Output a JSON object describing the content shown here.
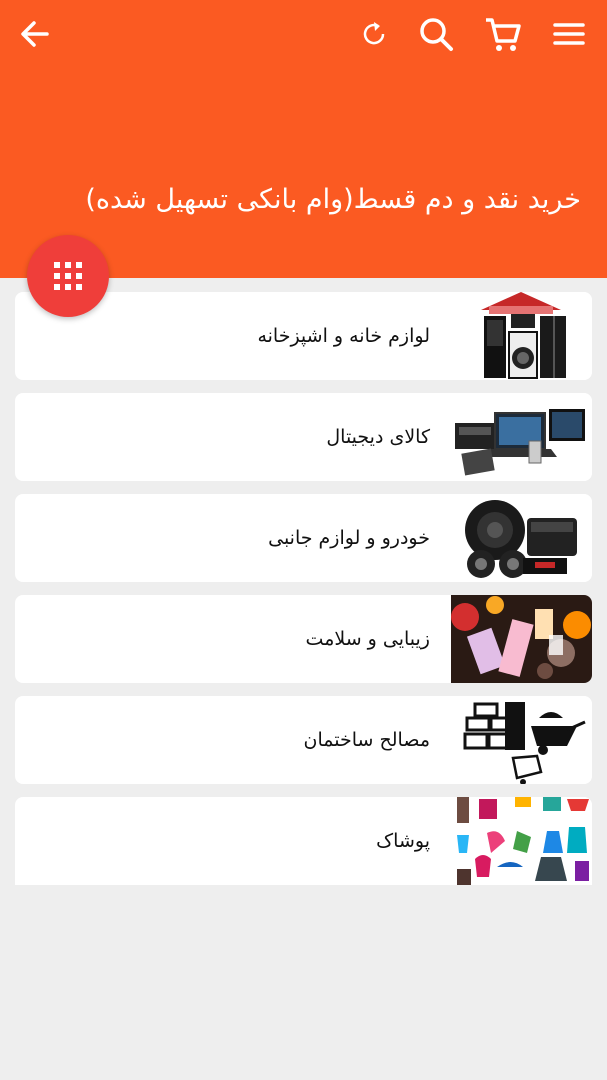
{
  "header": {
    "title": "خرید نقد و دم قسط(وام بانکی تسهیل شده)",
    "background_color": "#fb5a22",
    "icons": [
      "arrow-back-icon",
      "refresh-icon",
      "search-icon",
      "cart-icon",
      "menu-icon"
    ]
  },
  "fab": {
    "icon": "grid-icon",
    "color": "#ef3e3a"
  },
  "categories": [
    {
      "label": "لوازم خانه و اشپزخانه",
      "image": "home-appliances-thumbnail"
    },
    {
      "label": "کالای دیجیتال",
      "image": "digital-goods-thumbnail"
    },
    {
      "label": "خودرو و لوازم جانبی",
      "image": "car-audio-thumbnail"
    },
    {
      "label": "زیبایی و سلامت",
      "image": "beauty-health-thumbnail"
    },
    {
      "label": "مصالح ساختمان",
      "image": "building-materials-thumbnail"
    },
    {
      "label": "پوشاک",
      "image": "clothing-thumbnail"
    }
  ]
}
